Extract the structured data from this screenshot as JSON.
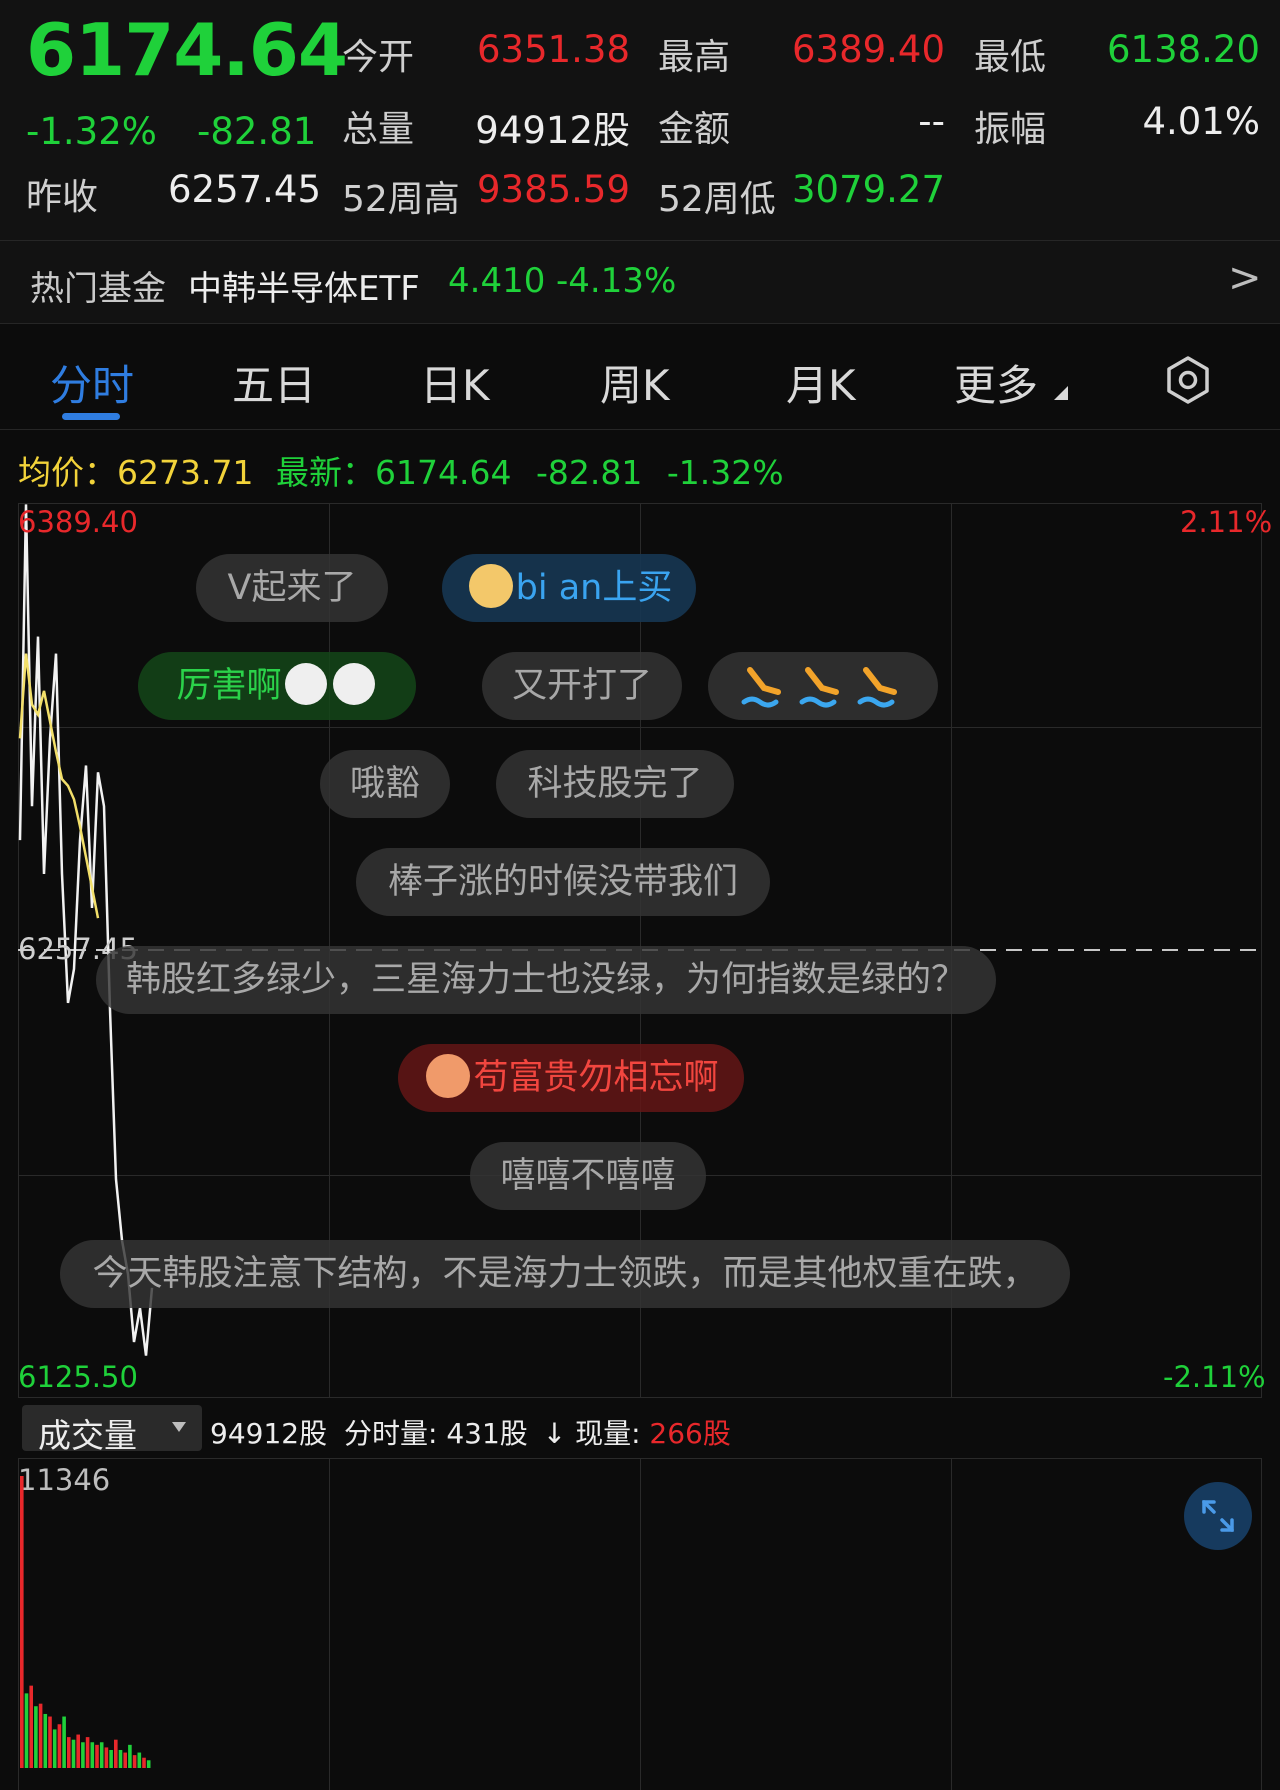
{
  "quote": {
    "price": "6174.64",
    "change_pct": "-1.32%",
    "change": "-82.81",
    "prev_close_label": "昨收",
    "prev_close": "6257.45",
    "open_label": "今开",
    "open": "6351.38",
    "high_label": "最高",
    "high": "6389.40",
    "low_label": "最低",
    "low": "6138.20",
    "volume_label": "总量",
    "volume": "94912股",
    "amount_label": "金额",
    "amount": "--",
    "amplitude_label": "振幅",
    "amplitude": "4.01%",
    "wk52_high_label": "52周高",
    "wk52_high": "9385.59",
    "wk52_low_label": "52周低",
    "wk52_low": "3079.27"
  },
  "hot_fund": {
    "label": "热门基金",
    "name": "中韩半导体ETF",
    "price": "4.410",
    "change": "-4.13%",
    "arrow": ">"
  },
  "tabs": [
    {
      "label": "分时",
      "active": true
    },
    {
      "label": "五日"
    },
    {
      "label": "日K"
    },
    {
      "label": "周K"
    },
    {
      "label": "月K"
    },
    {
      "label": "更多"
    }
  ],
  "settings_icon": "gear-icon",
  "info_line": {
    "avg_label": "均价：",
    "avg": "6273.71",
    "latest_label": "最新：",
    "latest": "6174.64",
    "change": "-82.81",
    "change_pct": "-1.32%"
  },
  "chart_axis": {
    "top_price": "6389.40",
    "mid_price": "6257.45",
    "bottom_price": "6125.50",
    "top_pct": "2.11%",
    "bottom_pct": "-2.11%"
  },
  "danmaku": [
    {
      "text": "V起来了"
    },
    {
      "text": "bi an上买",
      "icon": "rabbit-avatar-icon"
    },
    {
      "text": "厉害啊",
      "icon": "face-emoji-icon"
    },
    {
      "text": "又开打了"
    },
    {
      "text": "",
      "icon": "swimmer-emoji-icon"
    },
    {
      "text": "哦豁"
    },
    {
      "text": "科技股完了"
    },
    {
      "text": "棒子涨的时候没带我们"
    },
    {
      "text": "韩股红多绿少，三星海力士也没绿，为何指数是绿的？"
    },
    {
      "text": "苟富贵勿相忘啊",
      "icon": "cow-avatar-icon"
    },
    {
      "text": "嘻嘻不嘻嘻"
    },
    {
      "text": "今天韩股注意下结构，不是海力士领跌，而是其他权重在跌，"
    }
  ],
  "volume_bar": {
    "selector": "成交量",
    "total": "94912股",
    "minute_label": "分时量:",
    "minute_value": "431股",
    "current_label": "现量:",
    "current_value": "266股",
    "max": "11346"
  },
  "chart_data": {
    "type": "line",
    "ylim": [
      6125.5,
      6389.4
    ],
    "prev_close": 6257.45,
    "series": [
      {
        "values": [
          6290,
          6389,
          6300,
          6350,
          6280,
          6320,
          6345,
          6280,
          6242,
          6252,
          6290,
          6312,
          6270,
          6310,
          6300,
          6240,
          6190,
          6172,
          6162,
          6142,
          6152,
          6138,
          6158
        ]
      },
      {
        "values": [
          6320,
          6345,
          6330,
          6327,
          6334,
          6325,
          6316,
          6308,
          6306,
          6302,
          6294,
          6285,
          6276,
          6267
        ]
      }
    ],
    "volume": [
      11346,
      2900,
      3200,
      2400,
      2500,
      2100,
      2000,
      1500,
      1700,
      2000,
      1200,
      1100,
      1300,
      1000,
      1200,
      1000,
      900,
      1000,
      800,
      700,
      1100,
      700,
      600,
      900,
      500,
      600,
      400,
      300
    ]
  }
}
